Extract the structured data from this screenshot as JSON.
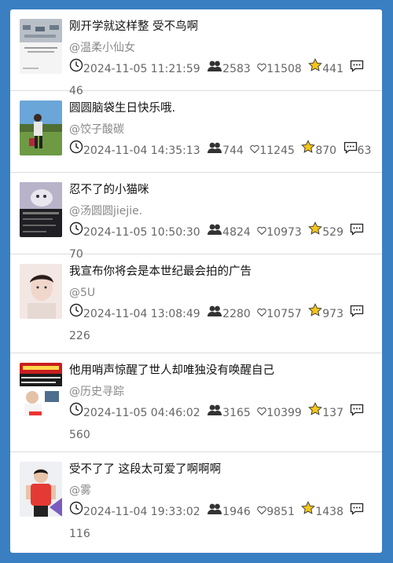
{
  "colors": {
    "background": "#3a7fc1",
    "panel": "#ffffff",
    "star": "#f5c518"
  },
  "icons": [
    "clock-icon",
    "viewers-icon",
    "heart-icon",
    "star-icon",
    "comment-icon"
  ],
  "items": [
    {
      "title": "刚开学就这样整 受不鸟啊",
      "author": "@温柔小仙女",
      "time": "2024-11-05 11:21:59",
      "views": "2583",
      "likes": "11508",
      "stars": "441",
      "comments": "46"
    },
    {
      "title": "圆圆脑袋生日快乐哦.",
      "author": "@饺子酸碳",
      "time": "2024-11-04 14:35:13",
      "views": "744",
      "likes": "11245",
      "stars": "870",
      "comments": "63"
    },
    {
      "title": "忍不了的小猫咪",
      "author": "@汤圆圆jiejie.",
      "time": "2024-11-05 10:50:30",
      "views": "4824",
      "likes": "10973",
      "stars": "529",
      "comments": "70"
    },
    {
      "title": "我宣布你将会是本世纪最会拍的广告",
      "author": "@5U",
      "time": "2024-11-04 13:08:49",
      "views": "2280",
      "likes": "10757",
      "stars": "973",
      "comments": "226"
    },
    {
      "title": "他用哨声惊醒了世人却唯独没有唤醒自己",
      "author": "@历史寻踪",
      "time": "2024-11-05 04:46:02",
      "views": "3165",
      "likes": "10399",
      "stars": "137",
      "comments": "560"
    },
    {
      "title": "受不了了 这段太可爱了啊啊啊",
      "author": "@雾",
      "time": "2024-11-04 19:33:02",
      "views": "1946",
      "likes": "9851",
      "stars": "1438",
      "comments": "116"
    }
  ]
}
